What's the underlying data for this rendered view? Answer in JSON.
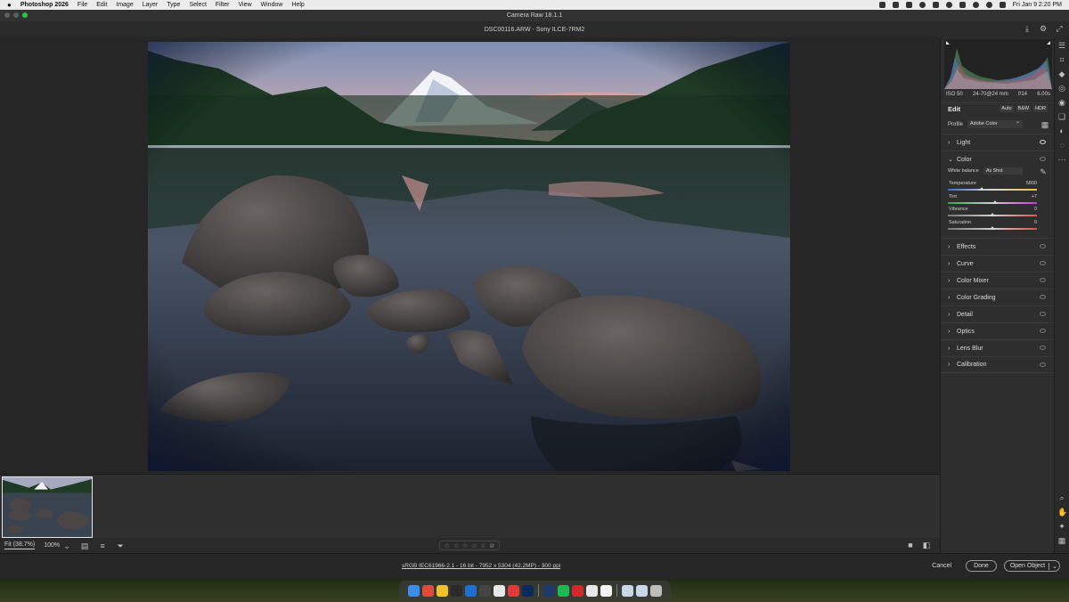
{
  "menubar": {
    "app_name": "Photoshop 2026",
    "menus": [
      "File",
      "Edit",
      "Image",
      "Layer",
      "Type",
      "Select",
      "Filter",
      "View",
      "Window",
      "Help"
    ],
    "clock": "Fri Jan 9  2:20 PM"
  },
  "window": {
    "title": "Camera Raw 18.1.1",
    "file_title": "DSC00116.ARW  -  Sony ILCE-7RM2"
  },
  "exif": {
    "iso": "ISO 50",
    "lens": "24-70@24 mm",
    "aperture": "f/14",
    "shutter": "6.00s"
  },
  "edit": {
    "title": "Edit",
    "buttons": {
      "auto": "Auto",
      "bw": "B&W",
      "hdr": "HDR"
    },
    "profile_label": "Profile",
    "profile_value": "Adobe Color"
  },
  "sections": {
    "light": "Light",
    "color": "Color",
    "effects": "Effects",
    "curve": "Curve",
    "color_mixer": "Color Mixer",
    "color_grading": "Color Grading",
    "detail": "Detail",
    "optics": "Optics",
    "lens_blur": "Lens Blur",
    "calibration": "Calibration"
  },
  "color_panel": {
    "wb_label": "White balance",
    "wb_value": "As Shot",
    "temperature": {
      "label": "Temperature",
      "value": "5800",
      "position": 0.38
    },
    "tint": {
      "label": "Tint",
      "value": "+7",
      "position": 0.53
    },
    "vibrance": {
      "label": "Vibrance",
      "value": "0",
      "position": 0.5
    },
    "saturation": {
      "label": "Saturation",
      "value": "0",
      "position": 0.5
    }
  },
  "bottombar": {
    "zoom_fit": "Fit (38.7%)",
    "zoom_level": "100%"
  },
  "statusbar": {
    "file_info": "sRGB IEC61966-2.1 - 16 bit - 7952 x 5304 (42.2MP) - 300 ppi",
    "cancel": "Cancel",
    "done": "Done",
    "open_object": "Open Object"
  },
  "colors": {
    "accent_green": "#28c840",
    "panel_bg": "#2e2e2e",
    "canvas_bg": "#262626"
  }
}
